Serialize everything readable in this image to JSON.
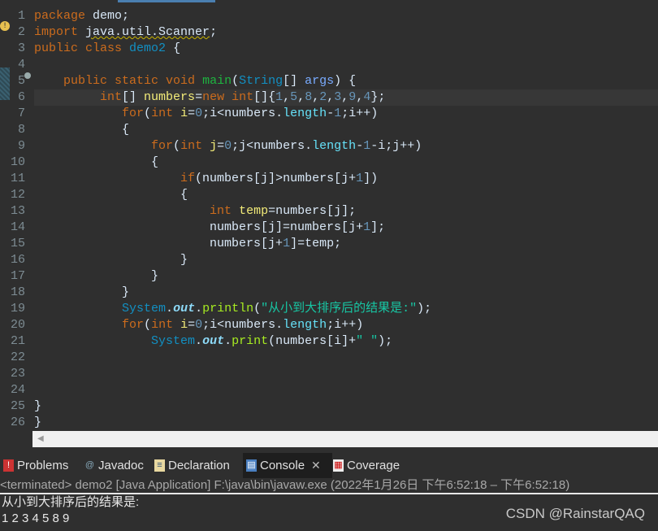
{
  "editor": {
    "lines": [
      {
        "n": "1",
        "t": [
          [
            "k",
            "package"
          ],
          [
            "t",
            " demo;"
          ]
        ]
      },
      {
        "n": "2",
        "t": [
          [
            "k",
            "import"
          ],
          [
            "t",
            " "
          ],
          [
            "tu",
            "java.util.Scanner"
          ],
          [
            "t",
            ";"
          ]
        ]
      },
      {
        "n": "3",
        "t": [
          [
            "k",
            "public class"
          ],
          [
            "t",
            " "
          ],
          [
            "c",
            "demo2"
          ],
          [
            "t",
            " {"
          ]
        ]
      },
      {
        "n": "4",
        "t": []
      },
      {
        "n": "5",
        "t": [
          [
            "t",
            "    "
          ],
          [
            "k",
            "public static void"
          ],
          [
            "t",
            " "
          ],
          [
            "m",
            "main"
          ],
          [
            "t",
            "("
          ],
          [
            "c",
            "String"
          ],
          [
            "t",
            "[] "
          ],
          [
            "a",
            "args"
          ],
          [
            "t",
            ") {"
          ]
        ]
      },
      {
        "n": "6",
        "t": [
          [
            "t",
            "         "
          ],
          [
            "k",
            "int"
          ],
          [
            "t",
            "[] "
          ],
          [
            "v",
            "numbers"
          ],
          [
            "t",
            "="
          ],
          [
            "k",
            "new"
          ],
          [
            "t",
            " "
          ],
          [
            "k",
            "int"
          ],
          [
            "t",
            "[]{"
          ],
          [
            "n",
            "1"
          ],
          [
            "t",
            ","
          ],
          [
            "n",
            "5"
          ],
          [
            "t",
            ","
          ],
          [
            "n",
            "8"
          ],
          [
            "t",
            ","
          ],
          [
            "n",
            "2"
          ],
          [
            "t",
            ","
          ],
          [
            "n",
            "3"
          ],
          [
            "t",
            ","
          ],
          [
            "n",
            "9"
          ],
          [
            "t",
            ","
          ],
          [
            "n",
            "4"
          ],
          [
            "t",
            "};"
          ]
        ],
        "current": true
      },
      {
        "n": "7",
        "t": [
          [
            "t",
            "            "
          ],
          [
            "k",
            "for"
          ],
          [
            "t",
            "("
          ],
          [
            "k",
            "int"
          ],
          [
            "t",
            " "
          ],
          [
            "v",
            "i"
          ],
          [
            "t",
            "="
          ],
          [
            "n",
            "0"
          ],
          [
            "t",
            ";i<numbers."
          ],
          [
            "f",
            "length"
          ],
          [
            "t",
            "-"
          ],
          [
            "n",
            "1"
          ],
          [
            "t",
            ";i++)"
          ]
        ]
      },
      {
        "n": "8",
        "t": [
          [
            "t",
            "            {"
          ]
        ]
      },
      {
        "n": "9",
        "t": [
          [
            "t",
            "                "
          ],
          [
            "k",
            "for"
          ],
          [
            "t",
            "("
          ],
          [
            "k",
            "int"
          ],
          [
            "t",
            " "
          ],
          [
            "v",
            "j"
          ],
          [
            "t",
            "="
          ],
          [
            "n",
            "0"
          ],
          [
            "t",
            ";j<numbers."
          ],
          [
            "f",
            "length"
          ],
          [
            "t",
            "-"
          ],
          [
            "n",
            "1"
          ],
          [
            "t",
            "-i;j++)"
          ]
        ]
      },
      {
        "n": "10",
        "t": [
          [
            "t",
            "                {"
          ]
        ]
      },
      {
        "n": "11",
        "t": [
          [
            "t",
            "                    "
          ],
          [
            "k",
            "if"
          ],
          [
            "t",
            "(numbers[j]>numbers[j+"
          ],
          [
            "n",
            "1"
          ],
          [
            "t",
            "])"
          ]
        ]
      },
      {
        "n": "12",
        "t": [
          [
            "t",
            "                    {"
          ]
        ]
      },
      {
        "n": "13",
        "t": [
          [
            "t",
            "                        "
          ],
          [
            "k",
            "int"
          ],
          [
            "t",
            " "
          ],
          [
            "v",
            "temp"
          ],
          [
            "t",
            "=numbers[j];"
          ]
        ]
      },
      {
        "n": "14",
        "t": [
          [
            "t",
            "                        numbers[j]=numbers[j+"
          ],
          [
            "n",
            "1"
          ],
          [
            "t",
            "];"
          ]
        ]
      },
      {
        "n": "15",
        "t": [
          [
            "t",
            "                        numbers[j+"
          ],
          [
            "n",
            "1"
          ],
          [
            "t",
            "]=temp;"
          ]
        ]
      },
      {
        "n": "16",
        "t": [
          [
            "t",
            "                    }"
          ]
        ]
      },
      {
        "n": "17",
        "t": [
          [
            "t",
            "                }"
          ]
        ]
      },
      {
        "n": "18",
        "t": [
          [
            "t",
            "            }"
          ]
        ]
      },
      {
        "n": "19",
        "t": [
          [
            "t",
            "            "
          ],
          [
            "c",
            "System"
          ],
          [
            "t",
            "."
          ],
          [
            "o",
            "out"
          ],
          [
            "t",
            "."
          ],
          [
            "mc",
            "println"
          ],
          [
            "t",
            "("
          ],
          [
            "s",
            "\"从小到大排序后的结果是:\""
          ],
          [
            "t",
            ");"
          ]
        ]
      },
      {
        "n": "20",
        "t": [
          [
            "t",
            "            "
          ],
          [
            "k",
            "for"
          ],
          [
            "t",
            "("
          ],
          [
            "k",
            "int"
          ],
          [
            "t",
            " "
          ],
          [
            "v",
            "i"
          ],
          [
            "t",
            "="
          ],
          [
            "n",
            "0"
          ],
          [
            "t",
            ";i<numbers."
          ],
          [
            "f",
            "length"
          ],
          [
            "t",
            ";i++)"
          ]
        ]
      },
      {
        "n": "21",
        "t": [
          [
            "t",
            "                "
          ],
          [
            "c",
            "System"
          ],
          [
            "t",
            "."
          ],
          [
            "o",
            "out"
          ],
          [
            "t",
            "."
          ],
          [
            "mc",
            "print"
          ],
          [
            "t",
            "(numbers[i]+"
          ],
          [
            "s",
            "\" \""
          ],
          [
            "t",
            ");"
          ]
        ]
      },
      {
        "n": "22",
        "t": []
      },
      {
        "n": "23",
        "t": []
      },
      {
        "n": "24",
        "t": []
      },
      {
        "n": "25",
        "t": [
          [
            "t",
            "}"
          ]
        ]
      },
      {
        "n": "26",
        "t": [
          [
            "t",
            "}"
          ]
        ]
      }
    ]
  },
  "tabs": [
    {
      "label": "Problems",
      "icon": "problems-icon"
    },
    {
      "label": "Javadoc",
      "icon": "javadoc-icon"
    },
    {
      "label": "Declaration",
      "icon": "declaration-icon"
    },
    {
      "label": "Console",
      "icon": "console-icon",
      "active": true
    },
    {
      "label": "Coverage",
      "icon": "coverage-icon"
    }
  ],
  "status": "<terminated> demo2 [Java Application] F:\\java\\bin\\javaw.exe  (2022年1月26日 下午6:52:18 – 下午6:52:18)",
  "console": {
    "lines": [
      "从小到大排序后的结果是:",
      "1 2 3 4 5 8 9"
    ]
  },
  "watermark": "CSDN @RainstarQAQ"
}
